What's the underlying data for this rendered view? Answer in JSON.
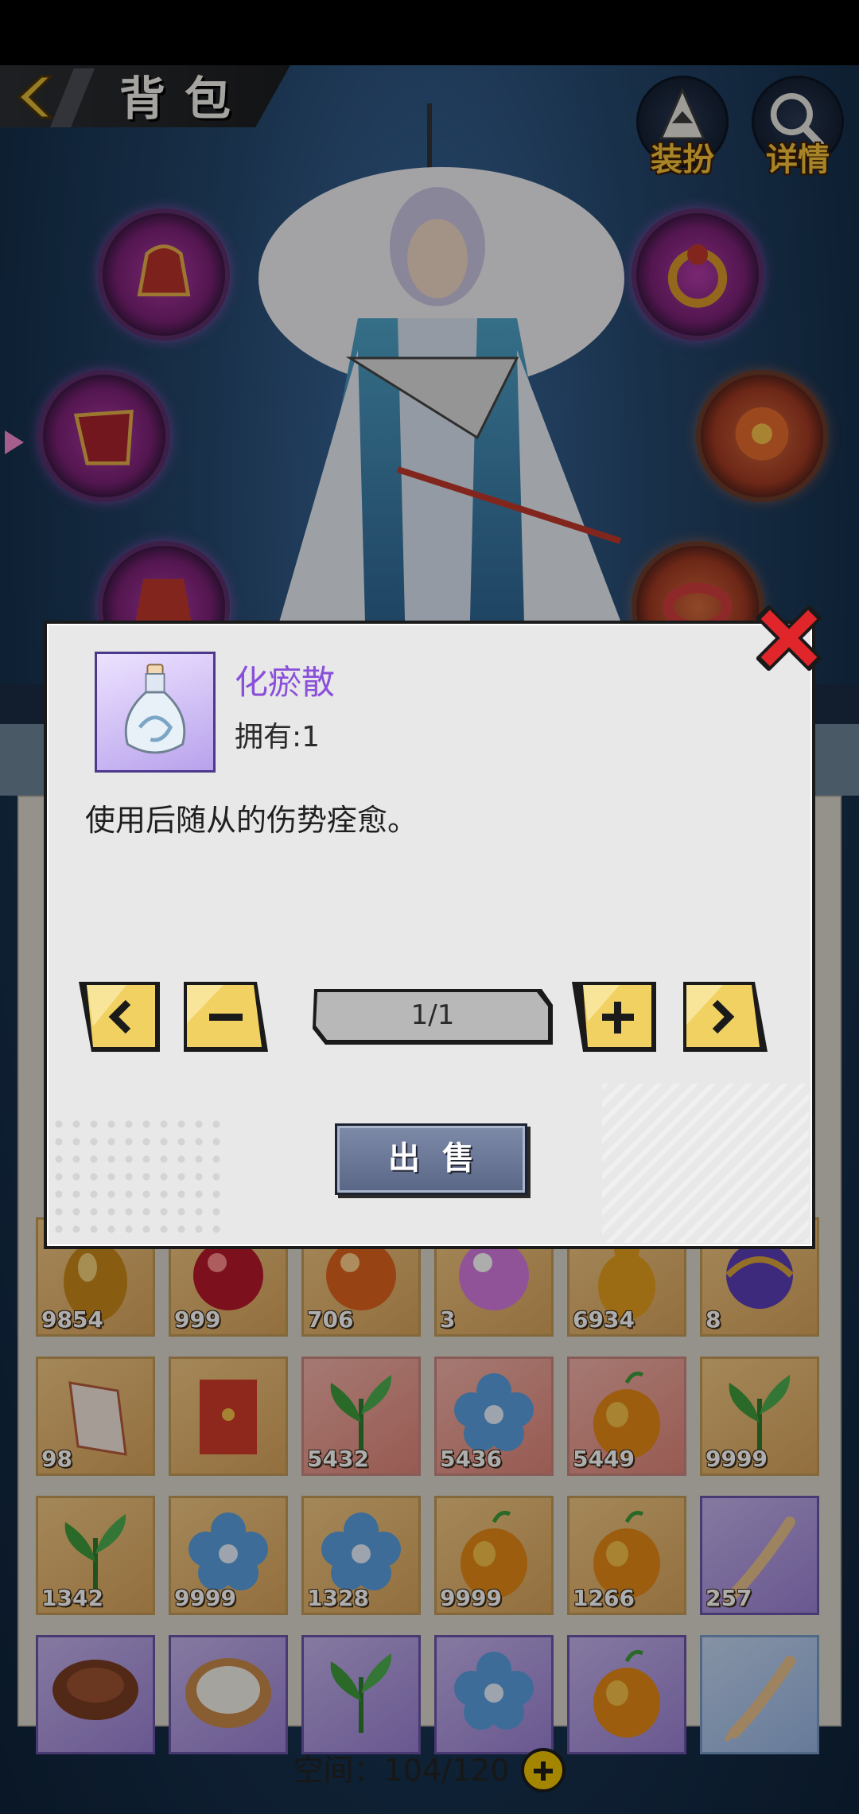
{
  "header": {
    "title": "背包",
    "dress_up_label": "装扮",
    "details_label": "详情"
  },
  "colors": {
    "item_name": "#8a4fdb",
    "button_yellow": "#f1d162",
    "sell_button": "#5a6686"
  },
  "dialog": {
    "item_name": "化瘀散",
    "owned": "拥有:1",
    "description": "使用后随从的伤势痊愈。",
    "quantity": "1/1",
    "sell_label": "出售",
    "icons": {
      "close": "close-icon",
      "prev": "chevron-left-icon",
      "minus": "minus-icon",
      "plus": "plus-icon",
      "next": "chevron-right-icon",
      "item": "potion-bottle-icon"
    }
  },
  "bag": {
    "rows": [
      [
        {
          "item": "golden-egg",
          "count": "9854",
          "rarity": "orange"
        },
        {
          "item": "red-orb",
          "count": "999",
          "rarity": "orange"
        },
        {
          "item": "fire-orb",
          "count": "706",
          "rarity": "orange"
        },
        {
          "item": "pink-pearl",
          "count": "3",
          "rarity": "orange"
        },
        {
          "item": "amber-gourd",
          "count": "6934",
          "rarity": "orange"
        },
        {
          "item": "purple-orb",
          "count": "8",
          "rarity": "orange"
        }
      ],
      [
        {
          "item": "paper-charm",
          "count": "98",
          "rarity": "orange"
        },
        {
          "item": "red-envelope",
          "count": "",
          "rarity": "orange"
        },
        {
          "item": "green-herb",
          "count": "5432",
          "rarity": "red"
        },
        {
          "item": "blue-flower",
          "count": "5436",
          "rarity": "red"
        },
        {
          "item": "golden-fruit",
          "count": "5449",
          "rarity": "red"
        },
        {
          "item": "green-herb",
          "count": "9999",
          "rarity": "orange"
        }
      ],
      [
        {
          "item": "green-herb",
          "count": "1342",
          "rarity": "orange"
        },
        {
          "item": "blue-flower",
          "count": "9999",
          "rarity": "orange"
        },
        {
          "item": "blue-flower",
          "count": "1328",
          "rarity": "orange"
        },
        {
          "item": "golden-fruit",
          "count": "9999",
          "rarity": "orange"
        },
        {
          "item": "golden-fruit",
          "count": "1266",
          "rarity": "orange"
        },
        {
          "item": "ginseng-root",
          "count": "257",
          "rarity": "purple"
        }
      ],
      [
        {
          "item": "lingzhi-mushroom",
          "count": "",
          "rarity": "purple"
        },
        {
          "item": "rice-bowl",
          "count": "",
          "rarity": "purple"
        },
        {
          "item": "green-herb",
          "count": "",
          "rarity": "purple"
        },
        {
          "item": "blue-flower",
          "count": "",
          "rarity": "purple"
        },
        {
          "item": "golden-fruit",
          "count": "",
          "rarity": "purple"
        },
        {
          "item": "ginseng-root",
          "count": "",
          "rarity": "blue"
        }
      ]
    ],
    "capacity": "空间：104/120"
  }
}
